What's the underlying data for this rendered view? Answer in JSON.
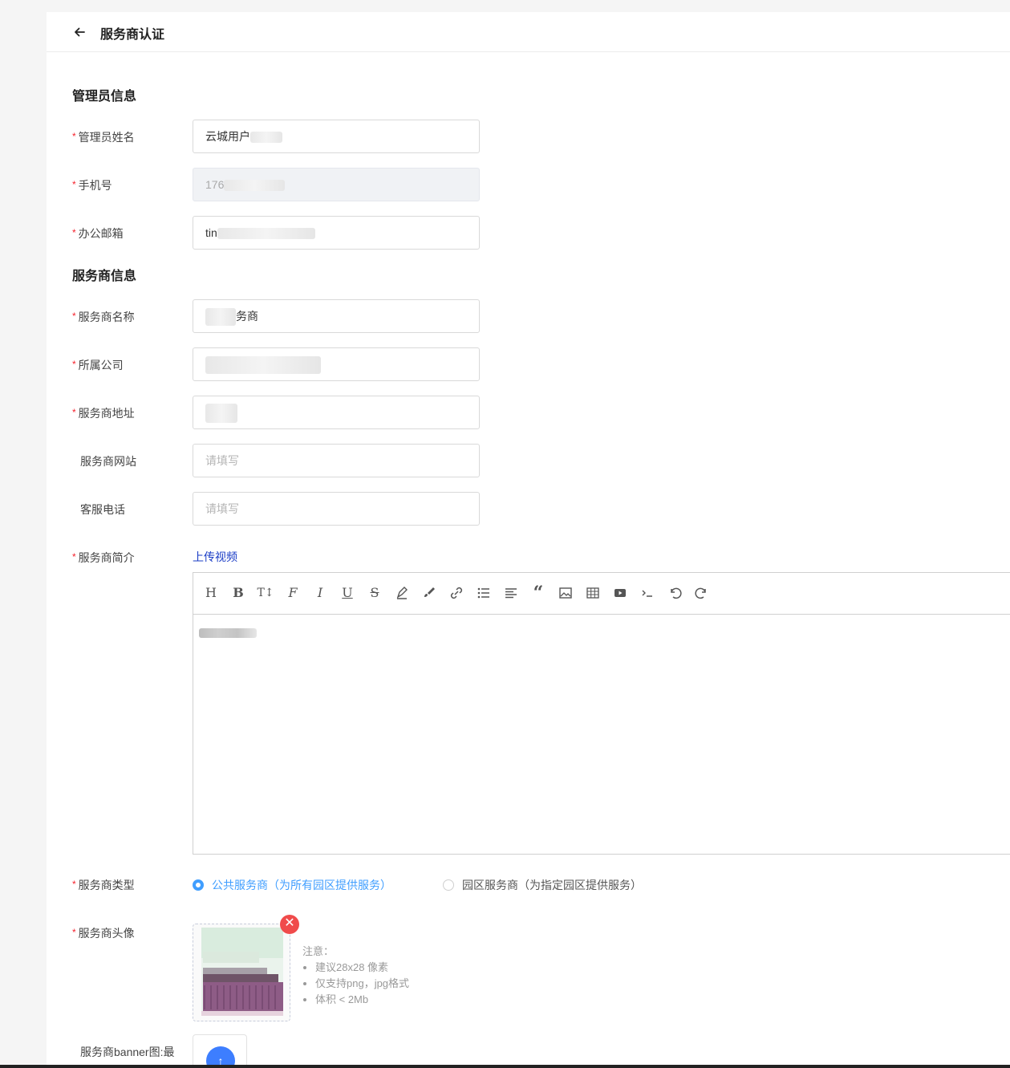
{
  "header": {
    "title": "服务商认证"
  },
  "admin_section": {
    "title": "管理员信息",
    "fields": [
      {
        "label": "管理员姓名",
        "value": "云城用户"
      },
      {
        "label": "手机号",
        "value": "176"
      },
      {
        "label": "办公邮箱",
        "value": "tin"
      }
    ]
  },
  "provider_section": {
    "title": "服务商信息",
    "fields": [
      {
        "label": "服务商名称",
        "value": "务商"
      },
      {
        "label": "所属公司",
        "value": ""
      },
      {
        "label": "服务商地址",
        "value": ""
      },
      {
        "label": "服务商网站",
        "placeholder": "请填写"
      },
      {
        "label": "客服电话",
        "placeholder": "请填写"
      }
    ],
    "intro": {
      "label": "服务商简介",
      "upload_video": "上传视频"
    },
    "type": {
      "label": "服务商类型",
      "options": [
        {
          "label": "公共服务商（为所有园区提供服务）",
          "selected": true
        },
        {
          "label": "园区服务商（为指定园区提供服务）",
          "selected": false
        }
      ]
    },
    "avatar": {
      "label": "服务商头像",
      "notes_title": "注意：",
      "notes": [
        "建议28x28 像素",
        "仅支持png，jpg格式",
        "体积 < 2Mb"
      ]
    },
    "banner": {
      "label": "服务商banner图:最"
    }
  },
  "colors": {
    "accent": "#409eff",
    "required": "#f5222d",
    "link": "#1a3cc6",
    "delete": "#f04b4b"
  }
}
